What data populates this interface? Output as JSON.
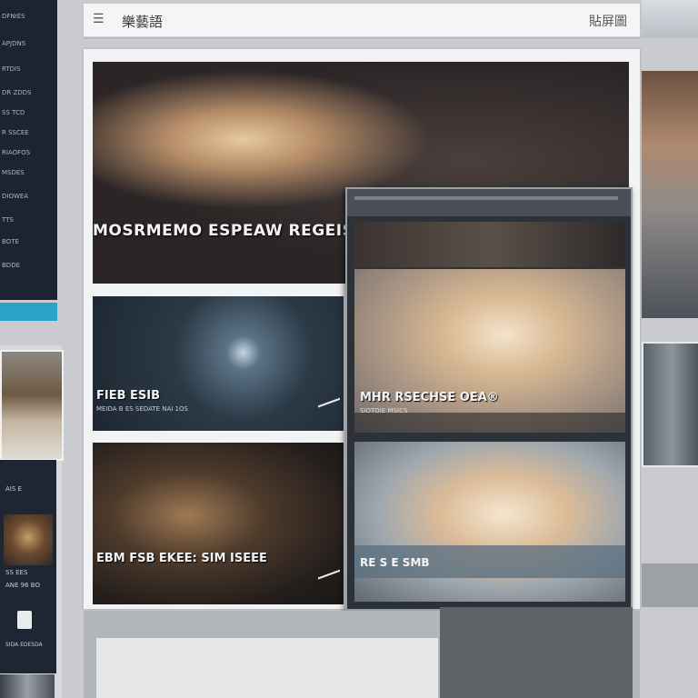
{
  "topbar": {
    "logo": "☰",
    "title": "樂藝語",
    "right_label": "貼屏圖"
  },
  "sidebar": {
    "items": [
      "DFNIES",
      "APJDNS",
      "RTDIS",
      "DR ZDDS",
      "SS TCD",
      "R SSCEE",
      "RIAOFOS",
      "MSDES",
      "DIOWEA",
      "TTS",
      "BOTE",
      "BDDE"
    ]
  },
  "hero": {
    "title": "MOSRMEMO ESPEAW REGEISO"
  },
  "cards": [
    {
      "caption": "FIEB ESIB",
      "sub": "MEIDA B ES SEDATE NAI 1OS"
    },
    {
      "caption": "EBM FSB EKEE: SIM ISEEE",
      "sub": ""
    }
  ],
  "overlay": {
    "caption1": "MHR RSECHSE OEA®",
    "caption2": "RE S E SMB",
    "meta1": "SIOTOIE MSICS"
  },
  "left_panel": {
    "label1": "AIS E",
    "label2": "SS EES",
    "label3": "ANE 96 BO",
    "label4": "SIDA EDESDA"
  },
  "colors": {
    "sidebar_bg": "#1c2431",
    "accent": "#2aa3c8",
    "topbar_bg": "#f4f5f6"
  }
}
